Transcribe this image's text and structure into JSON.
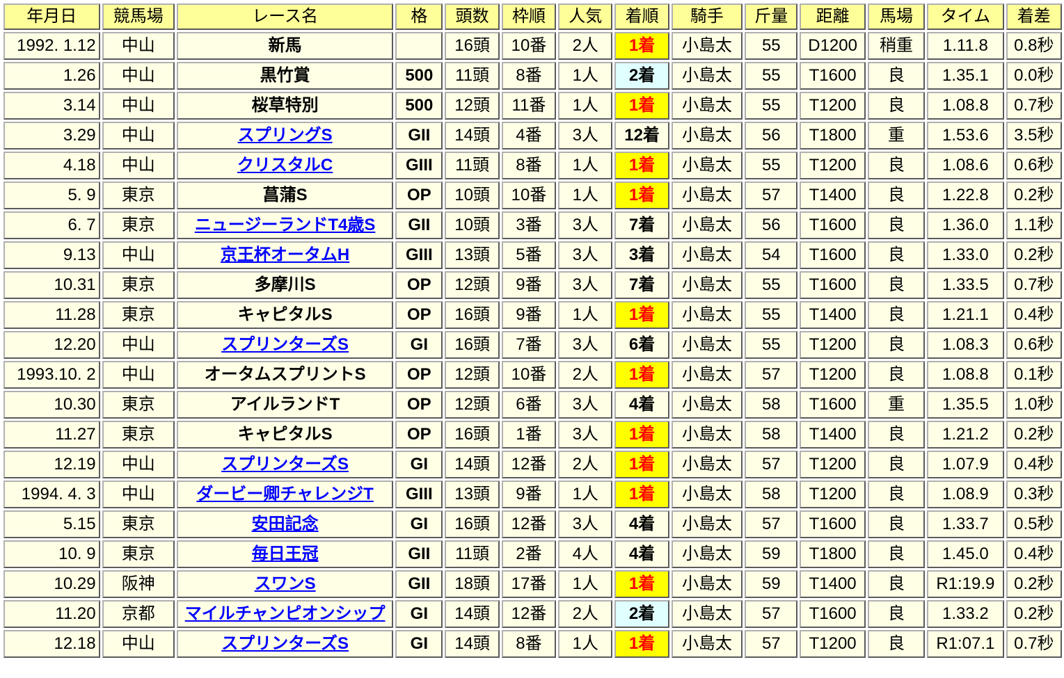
{
  "colors": {
    "header_bg": "#ffff99",
    "cell_bg": "#ffffe6",
    "win_bg": "#ffff00",
    "win_text": "#ff0000",
    "second_bg": "#e0ffff",
    "link": "#0000ff",
    "grade_G1": "#ff0000",
    "grade_G2": "#800080",
    "grade_G3": "#008000",
    "record_time": "#ff0000"
  },
  "headers": [
    "年月日",
    "競馬場",
    "レース名",
    "格",
    "頭数",
    "枠順",
    "人気",
    "着順",
    "騎手",
    "斤量",
    "距離",
    "馬場",
    "タイム",
    "着差"
  ],
  "rows": [
    {
      "date": "1992. 1.12",
      "course": "中山",
      "race": "新馬",
      "link": false,
      "grade": "",
      "grade_class": "",
      "runners": "16頭",
      "gate": "10番",
      "pop": "2人",
      "finish": "1着",
      "finish_class": "win",
      "jockey": "小島太",
      "weight": "55",
      "distance": "D1200",
      "going": "稍重",
      "time": "1.11.8",
      "record": false,
      "margin": "0.8秒"
    },
    {
      "date": "1.26",
      "course": "中山",
      "race": "黒竹賞",
      "link": false,
      "grade": "500",
      "grade_class": "",
      "runners": "11頭",
      "gate": "8番",
      "pop": "1人",
      "finish": "2着",
      "finish_class": "second",
      "jockey": "小島太",
      "weight": "55",
      "distance": "T1600",
      "going": "良",
      "time": "1.35.1",
      "record": false,
      "margin": "0.0秒"
    },
    {
      "date": "3.14",
      "course": "中山",
      "race": "桜草特別",
      "link": false,
      "grade": "500",
      "grade_class": "",
      "runners": "12頭",
      "gate": "11番",
      "pop": "1人",
      "finish": "1着",
      "finish_class": "win",
      "jockey": "小島太",
      "weight": "55",
      "distance": "T1200",
      "going": "良",
      "time": "1.08.8",
      "record": false,
      "margin": "0.7秒"
    },
    {
      "date": "3.29",
      "course": "中山",
      "race": "スプリングS",
      "link": true,
      "grade": "GII",
      "grade_class": "grade-g2",
      "runners": "14頭",
      "gate": "4番",
      "pop": "3人",
      "finish": "12着",
      "finish_class": "",
      "jockey": "小島太",
      "weight": "56",
      "distance": "T1800",
      "going": "重",
      "time": "1.53.6",
      "record": false,
      "margin": "3.5秒"
    },
    {
      "date": "4.18",
      "course": "中山",
      "race": "クリスタルC",
      "link": true,
      "grade": "GIII",
      "grade_class": "grade-g3",
      "runners": "11頭",
      "gate": "8番",
      "pop": "1人",
      "finish": "1着",
      "finish_class": "win",
      "jockey": "小島太",
      "weight": "55",
      "distance": "T1200",
      "going": "良",
      "time": "1.08.6",
      "record": false,
      "margin": "0.6秒"
    },
    {
      "date": "5. 9",
      "course": "東京",
      "race": "菖蒲S",
      "link": false,
      "grade": "OP",
      "grade_class": "",
      "runners": "10頭",
      "gate": "10番",
      "pop": "1人",
      "finish": "1着",
      "finish_class": "win",
      "jockey": "小島太",
      "weight": "57",
      "distance": "T1400",
      "going": "良",
      "time": "1.22.8",
      "record": false,
      "margin": "0.2秒"
    },
    {
      "date": "6. 7",
      "course": "東京",
      "race": "ニュージーランドT4歳S",
      "link": true,
      "grade": "GII",
      "grade_class": "grade-g2",
      "runners": "10頭",
      "gate": "3番",
      "pop": "3人",
      "finish": "7着",
      "finish_class": "",
      "jockey": "小島太",
      "weight": "56",
      "distance": "T1600",
      "going": "良",
      "time": "1.36.0",
      "record": false,
      "margin": "1.1秒"
    },
    {
      "date": "9.13",
      "course": "中山",
      "race": "京王杯オータムH",
      "link": true,
      "grade": "GIII",
      "grade_class": "grade-g3",
      "runners": "13頭",
      "gate": "5番",
      "pop": "3人",
      "finish": "3着",
      "finish_class": "",
      "jockey": "小島太",
      "weight": "54",
      "distance": "T1600",
      "going": "良",
      "time": "1.33.0",
      "record": false,
      "margin": "0.2秒"
    },
    {
      "date": "10.31",
      "course": "東京",
      "race": "多摩川S",
      "link": false,
      "grade": "OP",
      "grade_class": "",
      "runners": "12頭",
      "gate": "9番",
      "pop": "3人",
      "finish": "7着",
      "finish_class": "",
      "jockey": "小島太",
      "weight": "55",
      "distance": "T1600",
      "going": "良",
      "time": "1.33.5",
      "record": false,
      "margin": "0.7秒"
    },
    {
      "date": "11.28",
      "course": "東京",
      "race": "キャピタルS",
      "link": false,
      "grade": "OP",
      "grade_class": "",
      "runners": "16頭",
      "gate": "9番",
      "pop": "1人",
      "finish": "1着",
      "finish_class": "win",
      "jockey": "小島太",
      "weight": "55",
      "distance": "T1400",
      "going": "良",
      "time": "1.21.1",
      "record": false,
      "margin": "0.4秒"
    },
    {
      "date": "12.20",
      "course": "中山",
      "race": "スプリンターズS",
      "link": true,
      "grade": "GI",
      "grade_class": "grade-g1",
      "runners": "16頭",
      "gate": "7番",
      "pop": "3人",
      "finish": "6着",
      "finish_class": "",
      "jockey": "小島太",
      "weight": "55",
      "distance": "T1200",
      "going": "良",
      "time": "1.08.3",
      "record": false,
      "margin": "0.6秒"
    },
    {
      "date": "1993.10. 2",
      "course": "中山",
      "race": "オータムスプリントS",
      "link": false,
      "grade": "OP",
      "grade_class": "",
      "runners": "12頭",
      "gate": "10番",
      "pop": "2人",
      "finish": "1着",
      "finish_class": "win",
      "jockey": "小島太",
      "weight": "57",
      "distance": "T1200",
      "going": "良",
      "time": "1.08.8",
      "record": false,
      "margin": "0.1秒"
    },
    {
      "date": "10.30",
      "course": "東京",
      "race": "アイルランドT",
      "link": false,
      "grade": "OP",
      "grade_class": "",
      "runners": "12頭",
      "gate": "6番",
      "pop": "3人",
      "finish": "4着",
      "finish_class": "",
      "jockey": "小島太",
      "weight": "58",
      "distance": "T1600",
      "going": "重",
      "time": "1.35.5",
      "record": false,
      "margin": "1.0秒"
    },
    {
      "date": "11.27",
      "course": "東京",
      "race": "キャピタルS",
      "link": false,
      "grade": "OP",
      "grade_class": "",
      "runners": "16頭",
      "gate": "1番",
      "pop": "3人",
      "finish": "1着",
      "finish_class": "win",
      "jockey": "小島太",
      "weight": "58",
      "distance": "T1400",
      "going": "良",
      "time": "1.21.2",
      "record": false,
      "margin": "0.2秒"
    },
    {
      "date": "12.19",
      "course": "中山",
      "race": "スプリンターズS",
      "link": true,
      "grade": "GI",
      "grade_class": "grade-g1",
      "runners": "14頭",
      "gate": "12番",
      "pop": "2人",
      "finish": "1着",
      "finish_class": "win",
      "jockey": "小島太",
      "weight": "57",
      "distance": "T1200",
      "going": "良",
      "time": "1.07.9",
      "record": false,
      "margin": "0.4秒"
    },
    {
      "date": "1994. 4. 3",
      "course": "中山",
      "race": "ダービー卿チャレンジT",
      "link": true,
      "grade": "GIII",
      "grade_class": "grade-g3",
      "runners": "13頭",
      "gate": "9番",
      "pop": "1人",
      "finish": "1着",
      "finish_class": "win",
      "jockey": "小島太",
      "weight": "58",
      "distance": "T1200",
      "going": "良",
      "time": "1.08.9",
      "record": false,
      "margin": "0.3秒"
    },
    {
      "date": "5.15",
      "course": "東京",
      "race": "安田記念",
      "link": true,
      "grade": "GI",
      "grade_class": "grade-g1",
      "runners": "16頭",
      "gate": "12番",
      "pop": "3人",
      "finish": "4着",
      "finish_class": "",
      "jockey": "小島太",
      "weight": "57",
      "distance": "T1600",
      "going": "良",
      "time": "1.33.7",
      "record": false,
      "margin": "0.5秒"
    },
    {
      "date": "10. 9",
      "course": "東京",
      "race": "毎日王冠",
      "link": true,
      "grade": "GII",
      "grade_class": "grade-g2",
      "runners": "11頭",
      "gate": "2番",
      "pop": "4人",
      "finish": "4着",
      "finish_class": "",
      "jockey": "小島太",
      "weight": "59",
      "distance": "T1800",
      "going": "良",
      "time": "1.45.0",
      "record": false,
      "margin": "0.4秒"
    },
    {
      "date": "10.29",
      "course": "阪神",
      "race": "スワンS",
      "link": true,
      "grade": "GII",
      "grade_class": "grade-g2",
      "runners": "18頭",
      "gate": "17番",
      "pop": "1人",
      "finish": "1着",
      "finish_class": "win",
      "jockey": "小島太",
      "weight": "59",
      "distance": "T1400",
      "going": "良",
      "time": "R1:19.9",
      "record": true,
      "margin": "0.2秒"
    },
    {
      "date": "11.20",
      "course": "京都",
      "race": "マイルチャンピオンシップ",
      "link": true,
      "grade": "GI",
      "grade_class": "grade-g1",
      "runners": "14頭",
      "gate": "12番",
      "pop": "2人",
      "finish": "2着",
      "finish_class": "second",
      "jockey": "小島太",
      "weight": "57",
      "distance": "T1600",
      "going": "良",
      "time": "1.33.2",
      "record": false,
      "margin": "0.2秒"
    },
    {
      "date": "12.18",
      "course": "中山",
      "race": "スプリンターズS",
      "link": true,
      "grade": "GI",
      "grade_class": "grade-g1",
      "runners": "14頭",
      "gate": "8番",
      "pop": "1人",
      "finish": "1着",
      "finish_class": "win",
      "jockey": "小島太",
      "weight": "57",
      "distance": "T1200",
      "going": "良",
      "time": "R1:07.1",
      "record": true,
      "margin": "0.7秒"
    }
  ]
}
